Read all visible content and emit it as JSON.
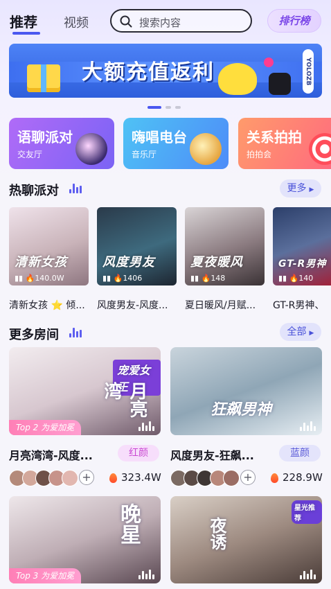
{
  "nav": {
    "tab_recommend": "推荐",
    "tab_video": "视频",
    "search_placeholder": "搜索内容",
    "rank_label": "排行榜"
  },
  "banner": {
    "title": "大额充值返利",
    "side_text": "YOLOZB",
    "pages": 3,
    "active_page": 1
  },
  "categories": [
    {
      "name": "语聊派对",
      "sub": "交友厅",
      "color": "#9b68f6"
    },
    {
      "name": "嗨唱电台",
      "sub": "音乐厅",
      "color": "#4da8f6"
    },
    {
      "name": "关系拍拍",
      "sub": "拍拍会",
      "color": "#ff7f73"
    }
  ],
  "hot_section": {
    "title": "热聊派对",
    "more_label": "更多",
    "cards": [
      {
        "overlay": "清新女孩",
        "listeners": "140.0W",
        "caption": "清新女孩 ⭐ 倾..."
      },
      {
        "overlay": "风度男友",
        "listeners": "1406",
        "caption": "风度男友-风度..."
      },
      {
        "overlay": "夏夜暖风",
        "listeners": "148",
        "caption": "夏日暖风/月赋..."
      },
      {
        "overlay": "GT-R男神",
        "listeners": "140",
        "caption": "GT-R男神、"
      }
    ]
  },
  "rooms_section": {
    "title": "更多房间",
    "all_label": "全部",
    "rooms": [
      {
        "name": "月亮湾湾-风度...",
        "badge": "红颜",
        "heat": "323.4W",
        "tag": "Top 2  为爱加冕",
        "poster": "月亮湾",
        "corner": "宠爱女王"
      },
      {
        "name": "风度男友-狂飙...",
        "badge": "蓝颜",
        "heat": "228.9W",
        "tag": "",
        "poster": "狂飙男神",
        "corner": ""
      },
      {
        "name": "",
        "badge": "",
        "heat": "",
        "tag": "Top 3  为爱加冕",
        "poster": "晚星",
        "corner": ""
      },
      {
        "name": "",
        "badge": "",
        "heat": "",
        "tag": "",
        "poster": "夜诱",
        "corner": "星光推荐"
      }
    ]
  },
  "colors": {
    "accent": "#4a57f0",
    "red_badge_bg": "#f7defb",
    "red_badge_text": "#c948d2",
    "blue_badge_bg": "#e4e4fb",
    "blue_badge_text": "#5a5ad8"
  }
}
